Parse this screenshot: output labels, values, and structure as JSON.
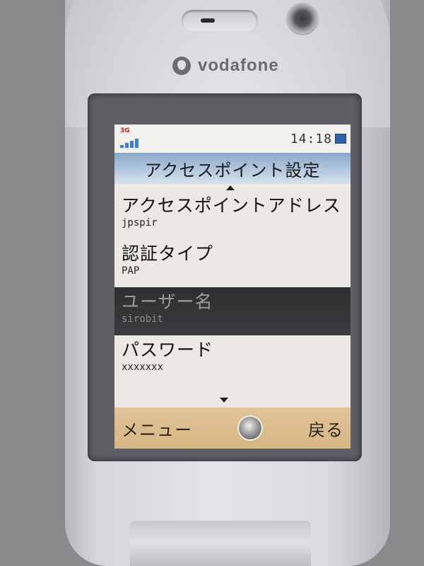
{
  "device": {
    "brand": "vodafone",
    "logo_icon": "vodafone-logo-icon"
  },
  "status": {
    "network_label": "3G",
    "signal_bars": 4,
    "time": "14:18",
    "battery_icon": "battery-icon"
  },
  "screen": {
    "title": "アクセスポイント設定",
    "items": [
      {
        "label": "アクセスポイントアドレス",
        "value": "jpspir",
        "selected": false
      },
      {
        "label": "認証タイプ",
        "value": "PAP",
        "selected": false
      },
      {
        "label": "ユーザー名",
        "value": "sirobit",
        "selected": true
      },
      {
        "label": "パスワード",
        "value": "xxxxxxx",
        "selected": false
      }
    ]
  },
  "softkeys": {
    "left": "メニュー",
    "right": "戻る",
    "center_icon": "center-select-icon"
  },
  "colors": {
    "title_bar": "#b8cbe0",
    "selected_row": "#333336",
    "softkey_bar": "#d7b682"
  }
}
